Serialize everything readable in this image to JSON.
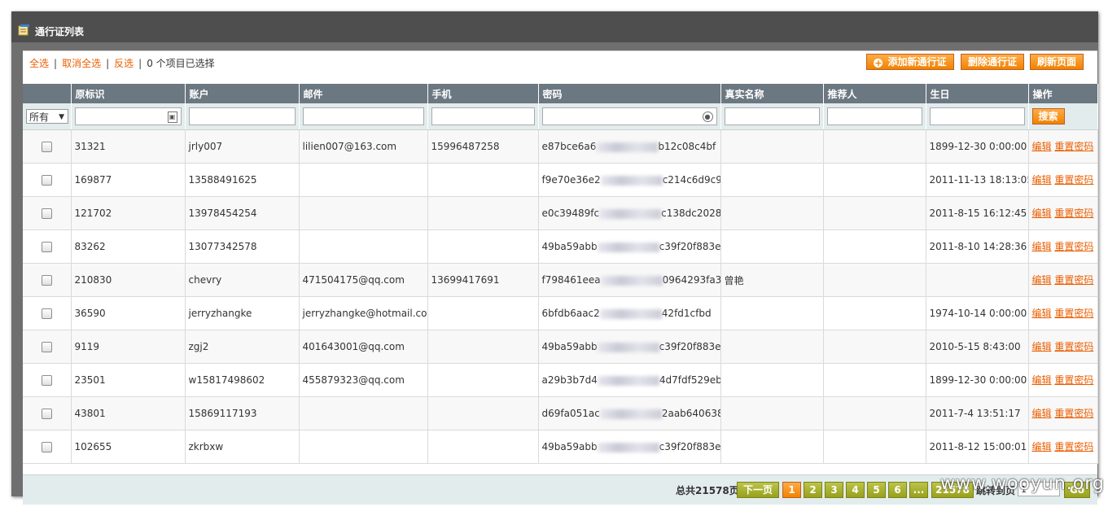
{
  "window": {
    "title": "通行证列表"
  },
  "selection": {
    "select_all": "全选",
    "deselect_all": "取消全选",
    "invert": "反选",
    "count": "0 个项目已选择"
  },
  "actions": {
    "add": "添加新通行证",
    "delete": "删除通行证",
    "refresh": "刷新页面"
  },
  "columns": [
    "原标识",
    "账户",
    "邮件",
    "手机",
    "密码",
    "真实名称",
    "推荐人",
    "生日",
    "操作"
  ],
  "filter": {
    "select_value": "所有",
    "search_button": "搜索"
  },
  "rows": [
    {
      "id": "31321",
      "account": "jrly007",
      "email": "lilien007@163.com",
      "phone": "15996487258",
      "pw_a": "e87bce6a6",
      "pw_b": "b12c08c4bf",
      "name": "",
      "referrer": "",
      "birthday": "1899-12-30 0:00:00"
    },
    {
      "id": "169877",
      "account": "13588491625",
      "email": "",
      "phone": "",
      "pw_a": "f9e70e36e2",
      "pw_b": "c214c6d9c9",
      "name": "",
      "referrer": "",
      "birthday": "2011-11-13 18:13:05"
    },
    {
      "id": "121702",
      "account": "13978454254",
      "email": "",
      "phone": "",
      "pw_a": "e0c39489fc",
      "pw_b": "c138dc2028",
      "name": "",
      "referrer": "",
      "birthday": "2011-8-15 16:12:45"
    },
    {
      "id": "83262",
      "account": "13077342578",
      "email": "",
      "phone": "",
      "pw_a": "49ba59abb",
      "pw_b": "c39f20f883e",
      "name": "",
      "referrer": "",
      "birthday": "2011-8-10 14:28:36"
    },
    {
      "id": "210830",
      "account": "chevry",
      "email": "471504175@qq.com",
      "phone": "13699417691",
      "pw_a": "f798461eea",
      "pw_b": "0964293fa37",
      "name": "曾艳",
      "referrer": "",
      "birthday": ""
    },
    {
      "id": "36590",
      "account": "jerryzhangke",
      "email": "jerryzhangke@hotmail.com",
      "phone": "",
      "pw_a": "6bfdb6aac2",
      "pw_b": "42fd1cfbd",
      "name": "",
      "referrer": "",
      "birthday": "1974-10-14 0:00:00"
    },
    {
      "id": "9119",
      "account": "zgj2",
      "email": "401643001@qq.com",
      "phone": "",
      "pw_a": "49ba59abb",
      "pw_b": "c39f20f883e",
      "name": "",
      "referrer": "",
      "birthday": "2010-5-15 8:43:00"
    },
    {
      "id": "23501",
      "account": "w15817498602",
      "email": "455879323@qq.com",
      "phone": "",
      "pw_a": "a29b3b7d4",
      "pw_b": "4d7fdf529eb",
      "name": "",
      "referrer": "",
      "birthday": "1899-12-30 0:00:00"
    },
    {
      "id": "43801",
      "account": "15869117193",
      "email": "",
      "phone": "",
      "pw_a": "d69fa051ac",
      "pw_b": "2aab640638",
      "name": "",
      "referrer": "",
      "birthday": "2011-7-4 13:51:17"
    },
    {
      "id": "102655",
      "account": "zkrbxw",
      "email": "",
      "phone": "",
      "pw_a": "49ba59abb",
      "pw_b": "c39f20f883e",
      "name": "",
      "referrer": "",
      "birthday": "2011-8-12 15:00:01"
    }
  ],
  "row_ops": {
    "edit": "编辑",
    "reset": "重置密码"
  },
  "pager": {
    "total": "总共21578页",
    "next": "下一页",
    "pages": [
      "1",
      "2",
      "3",
      "4",
      "5",
      "6",
      "...",
      "21578"
    ],
    "current": "1",
    "jump_label": "跳转到页",
    "jump_value": "1",
    "go": "Go"
  },
  "watermark": "www.wooyun.org",
  "colors": {
    "accent": "#f18200",
    "link": "#eb5e00",
    "header": "#6b7781",
    "pager_button": "#98a01c"
  }
}
